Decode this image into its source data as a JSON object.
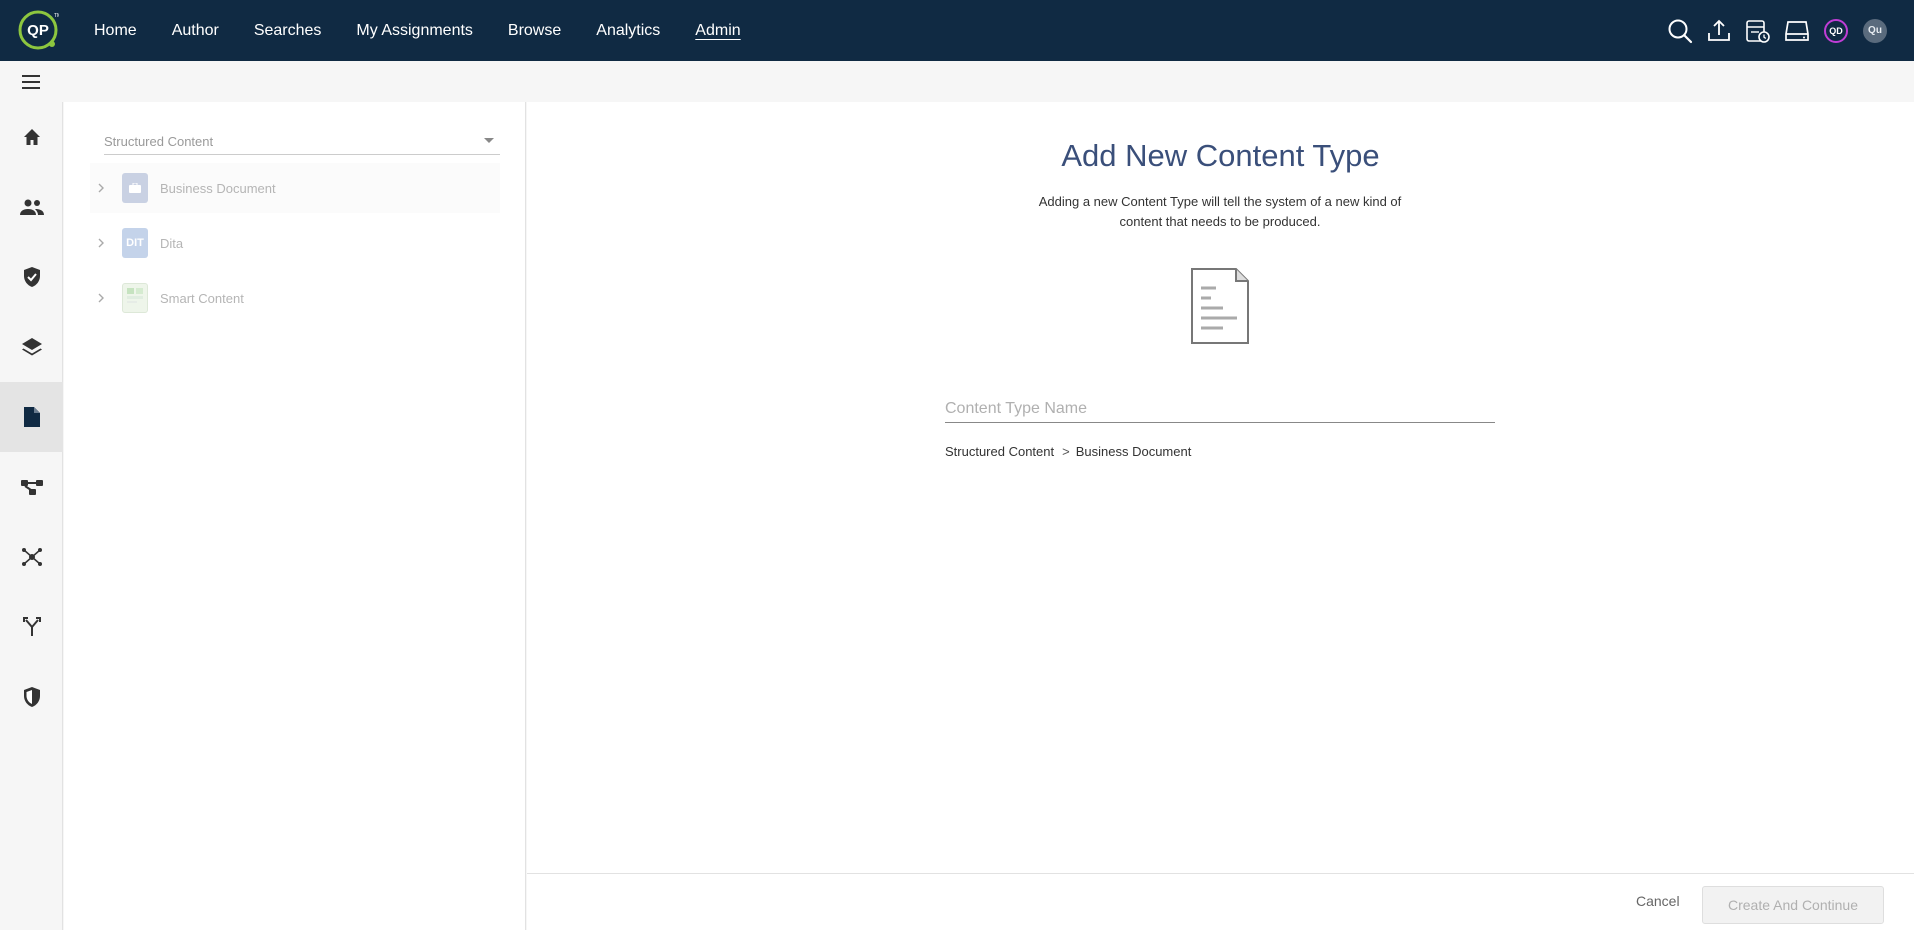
{
  "topbar": {
    "logo_text": "QP",
    "nav": [
      {
        "label": "Home"
      },
      {
        "label": "Author"
      },
      {
        "label": "Searches"
      },
      {
        "label": "My Assignments"
      },
      {
        "label": "Browse"
      },
      {
        "label": "Analytics"
      },
      {
        "label": "Admin",
        "active": true
      }
    ],
    "icons": [
      "search-icon",
      "upload-icon",
      "scheduled-tasks-icon",
      "inbox-icon"
    ],
    "avatar_qd": "QD",
    "avatar_qu": "Qu"
  },
  "sidebar": {
    "items": [
      "home-icon",
      "users-icon",
      "shield-check-icon",
      "layers-icon",
      "document-icon",
      "workflow-icon",
      "network-icon",
      "branch-icon",
      "security-shield-icon"
    ],
    "active_index": 4
  },
  "tree": {
    "select_value": "Structured Content",
    "items": [
      {
        "label": "Business Document",
        "icon": "business-document-icon",
        "icon_text": ""
      },
      {
        "label": "Dita",
        "icon": "dita-icon",
        "icon_text": "DIT"
      },
      {
        "label": "Smart Content",
        "icon": "smart-content-icon",
        "icon_text": ""
      }
    ]
  },
  "main": {
    "title": "Add New Content Type",
    "description": "Adding a new Content Type will tell the system of a new kind of content that needs to be produced.",
    "name_placeholder": "Content Type Name",
    "name_value": "",
    "path_root": "Structured Content",
    "path_separator": ">",
    "path_leaf": "Business Document"
  },
  "footer": {
    "cancel_label": "Cancel",
    "create_label": "Create And Continue"
  },
  "colors": {
    "topbar_bg": "#102a43",
    "logo_green": "#8dc63f",
    "title_color": "#3a4f7a",
    "avatar_ring": "#c03dd6"
  }
}
